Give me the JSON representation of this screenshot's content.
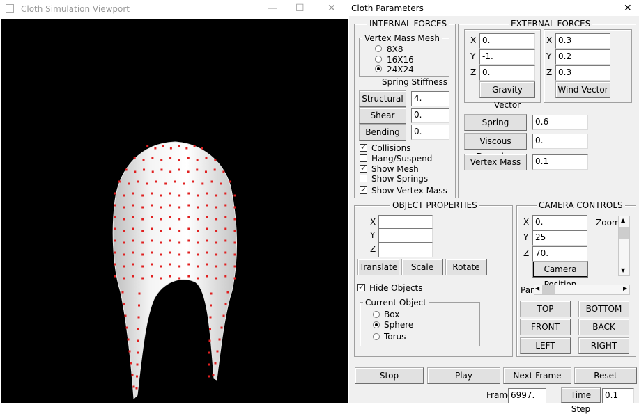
{
  "viewport": {
    "title": "Cloth Simulation Viewport",
    "minimize": "—",
    "maximize": "☐",
    "close": "✕"
  },
  "params": {
    "title": "Cloth Parameters",
    "close": "✕",
    "internal": {
      "title": "INTERNAL FORCES",
      "mass_title": "Vertex Mass Mesh",
      "mesh_options": [
        "8X8",
        "16X16",
        "24X24"
      ],
      "mesh_selected": "24X24",
      "stiffness_title": "Spring Stiffness",
      "structural_label": "Structural",
      "structural_value": "4.",
      "shear_label": "Shear",
      "shear_value": "0.",
      "bending_label": "Bending",
      "bending_value": "0.",
      "checks": [
        {
          "label": "Collisions",
          "checked": true
        },
        {
          "label": "Hang/Suspend",
          "checked": false
        },
        {
          "label": "Show Mesh",
          "checked": true
        },
        {
          "label": "Show Springs",
          "checked": false
        },
        {
          "label": "Show Vertex Mass",
          "checked": true
        }
      ]
    },
    "external": {
      "title": "EXTERNAL FORCES",
      "gravity": {
        "x": "0.",
        "y": "-1.",
        "z": "0.",
        "button": "Gravity Vector"
      },
      "wind": {
        "x": "0.3",
        "y": "0.2",
        "z": "0.3",
        "button": "Wind Vector"
      },
      "axis_x": "X",
      "axis_y": "Y",
      "axis_z": "Z",
      "spring_damping_label": "Spring Damping",
      "spring_damping_value": "0.6",
      "viscous_damping_label": "Viscous Damping",
      "viscous_damping_value": "0.",
      "vertex_mass_label": "Vertex Mass",
      "vertex_mass_value": "0.1"
    },
    "object": {
      "title": "OBJECT PROPERTIES",
      "x": "",
      "y": "",
      "z": "",
      "translate": "Translate",
      "scale": "Scale",
      "rotate": "Rotate",
      "hide_label": "Hide Objects",
      "hide_checked": true,
      "current_title": "Current Object",
      "options": [
        "Box",
        "Sphere",
        "Torus"
      ],
      "selected": "Sphere"
    },
    "camera": {
      "title": "CAMERA CONTROLS",
      "x": "0.",
      "y": "25",
      "z": "70.",
      "zoom_label": "Zoom",
      "position_button": "Camera Position",
      "pan_label": "Pan",
      "views": [
        "TOP",
        "BOTTOM",
        "FRONT",
        "BACK",
        "LEFT",
        "RIGHT"
      ]
    },
    "controls": {
      "stop": "Stop",
      "play": "Play",
      "next": "Next Frame",
      "reset": "Reset",
      "frame_label": "Frame",
      "frame_value": "6997.",
      "timestep_label": "Time Step",
      "timestep_value": "0.1"
    }
  },
  "colors": {
    "vertex": "#e02020",
    "cloth": "#f2f2f2",
    "canvas": "#000000"
  }
}
